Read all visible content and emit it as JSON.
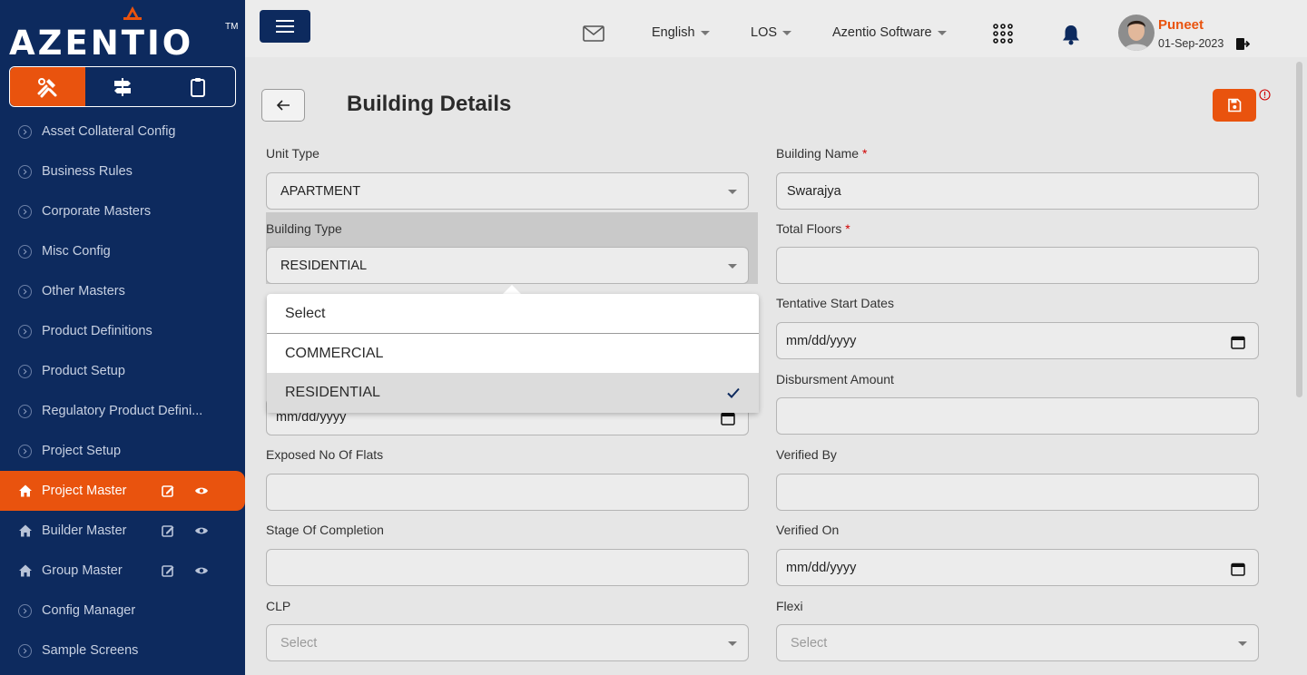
{
  "brand": {
    "name": "AZENTIO",
    "tm": "TM"
  },
  "sidebar": {
    "modes": [
      "tools-icon",
      "signpost-icon",
      "clipboard-icon"
    ],
    "items": [
      {
        "label": "Asset Collateral Config"
      },
      {
        "label": "Business Rules"
      },
      {
        "label": "Corporate Masters"
      },
      {
        "label": "Misc Config"
      },
      {
        "label": "Other Masters"
      },
      {
        "label": "Product Definitions"
      },
      {
        "label": "Product Setup"
      },
      {
        "label": "Regulatory Product Defini..."
      },
      {
        "label": "Project Setup"
      },
      {
        "label": "Project Master"
      },
      {
        "label": "Builder Master"
      },
      {
        "label": "Group Master"
      },
      {
        "label": "Config Manager"
      },
      {
        "label": "Sample Screens"
      }
    ],
    "active_item": "Project Master"
  },
  "header": {
    "language": "English",
    "module": "LOS",
    "company": "Azentio Software",
    "user_name": "Puneet",
    "user_date": "01-Sep-2023"
  },
  "page": {
    "title": "Building Details"
  },
  "form": {
    "unit_type": {
      "label": "Unit Type",
      "value": "APARTMENT"
    },
    "building_name": {
      "label": "Building Name",
      "required": "*",
      "value": "Swarajya"
    },
    "building_type": {
      "label": "Building Type",
      "value": "RESIDENTIAL"
    },
    "total_floors": {
      "label": "Total Floors",
      "required": "*",
      "value": ""
    },
    "tentative_start_dates": {
      "label": "Tentative Start Dates",
      "value": "mm/dd/yyyy"
    },
    "tentative_end_date": {
      "value": "mm/dd/yyyy"
    },
    "disbursment_amount": {
      "label": "Disbursment Amount",
      "value": ""
    },
    "exposed_no_of_flats": {
      "label": "Exposed No Of Flats",
      "value": ""
    },
    "verified_by": {
      "label": "Verified By",
      "value": ""
    },
    "stage_of_completion": {
      "label": "Stage Of Completion",
      "value": ""
    },
    "verified_on": {
      "label": "Verified On",
      "value": "mm/dd/yyyy"
    },
    "clp": {
      "label": "CLP",
      "placeholder": "Select"
    },
    "flexi": {
      "label": "Flexi",
      "placeholder": "Select"
    }
  },
  "dropdown": {
    "options": [
      "Select",
      "COMMERCIAL",
      "RESIDENTIAL"
    ],
    "selected": "RESIDENTIAL"
  },
  "colors": {
    "sidebar_bg": "#0d2a5e",
    "accent": "#e9530e",
    "required": "#d00000"
  }
}
